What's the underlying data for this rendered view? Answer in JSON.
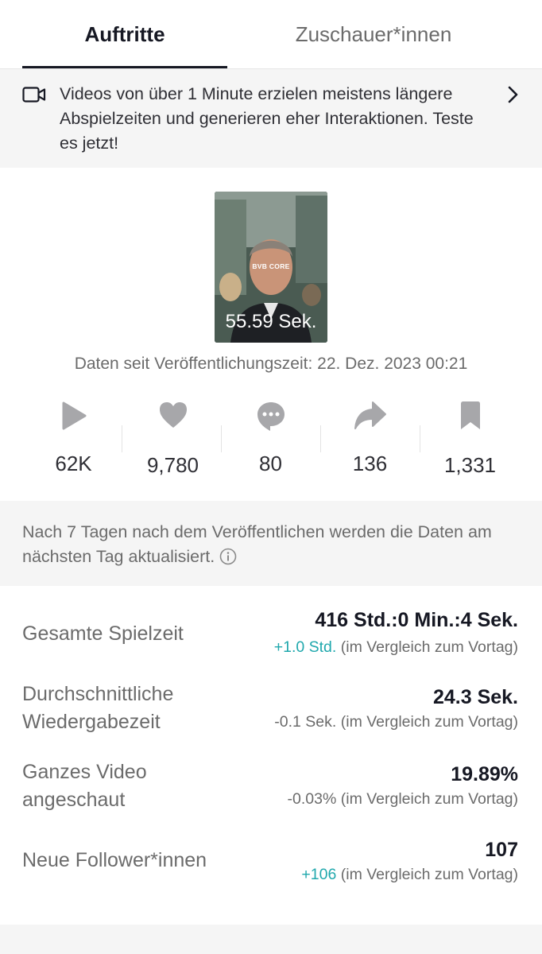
{
  "tabs": [
    {
      "label": "Auftritte",
      "active": true
    },
    {
      "label": "Zuschauer*innen",
      "active": false
    }
  ],
  "tip": {
    "icon": "video-camera-icon",
    "text": "Videos von über 1 Minute erzielen meistens längere Abspielzeiten und generieren eher Interaktionen. Teste es jetzt!"
  },
  "video": {
    "brand": "BVB CORE",
    "duration": "55.59 Sek.",
    "published": "Daten seit Veröffentlichungszeit: 22. Dez. 2023 00:21"
  },
  "stats": [
    {
      "icon": "play-icon",
      "value": "62K"
    },
    {
      "icon": "heart-icon",
      "value": "9,780"
    },
    {
      "icon": "comment-icon",
      "value": "80"
    },
    {
      "icon": "share-icon",
      "value": "136"
    },
    {
      "icon": "bookmark-icon",
      "value": "1,331"
    }
  ],
  "note": {
    "text": "Nach 7 Tagen nach dem Veröffentlichen werden die Daten am nächsten Tag aktualisiert."
  },
  "metrics": [
    {
      "label": "Gesamte Spielzeit",
      "value": "416 Std.:0 Min.:4 Sek.",
      "delta": "+1.0 Std.",
      "compare": " (im Vergleich zum Vortag)"
    },
    {
      "label_line1": "Durchschnittliche",
      "label_line2": "Wiedergabezeit",
      "value": "24.3 Sek.",
      "delta": "-0.1 Sek.",
      "compare": " (im Vergleich zum Vortag)"
    },
    {
      "label_line1": "Ganzes Video",
      "label_line2": "angeschaut",
      "value": "19.89%",
      "delta": "-0.03%",
      "compare": " (im Vergleich zum Vortag)"
    },
    {
      "label": "Neue Follower*innen",
      "value": "107",
      "delta": "+106",
      "compare": " (im Vergleich zum Vortag)"
    }
  ],
  "colors": {
    "positive": "#20a8ad",
    "text": "#161823",
    "muted": "#6b6b6b",
    "icon": "#a7a7aa",
    "panel": "#f5f5f5"
  }
}
